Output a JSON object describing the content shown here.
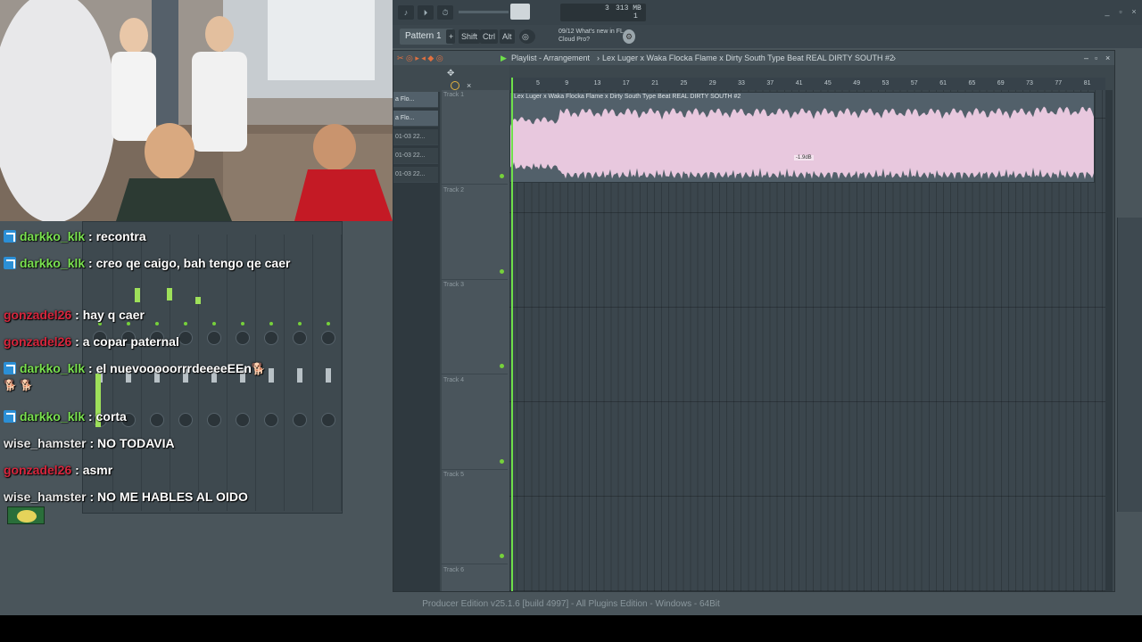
{
  "toolbar": {
    "cpu_top": "313 MB",
    "cpu_left": "3",
    "cpu_bottom": "1"
  },
  "row2": {
    "pattern": "Pattern 1",
    "shift": "Shift",
    "ctrl": "Ctrl",
    "alt": "Alt",
    "news_line1": "09/12  What's new in FL",
    "news_line2": "Cloud Pro?"
  },
  "playlist": {
    "title": "Playlist - Arrangement",
    "song": "Lex Luger x Waka Flocka Flame x Dirty South Type Beat REAL DIRTY SOUTH #2",
    "clip_label": "Lex Luger x Waka Flocka Flame x Dirty South Type Beat REAL DIRTY SOUTH #2",
    "clip_gain": "-1.9dB",
    "ruler": [
      "5",
      "9",
      "13",
      "17",
      "21",
      "25",
      "29",
      "33",
      "37",
      "41",
      "45",
      "49",
      "53",
      "57",
      "61",
      "65",
      "69",
      "73",
      "77",
      "81"
    ],
    "picker": [
      {
        "label": "a Flo..."
      },
      {
        "label": "a Flo..."
      },
      {
        "label": "01-03 22..."
      },
      {
        "label": "01-03 22..."
      },
      {
        "label": "01-03 22..."
      }
    ],
    "tracks": [
      "Track 1",
      "Track 2",
      "Track 3",
      "Track 4",
      "Track 5",
      "Track 6"
    ]
  },
  "chat": [
    {
      "user": "darkko_klk",
      "color": "green",
      "badge": true,
      "text": ": recontra"
    },
    {
      "user": "darkko_klk",
      "color": "green",
      "badge": true,
      "text": ": creo qe caigo, bah tengo qe caer"
    },
    {
      "user": "gonzadel26",
      "color": "red",
      "badge": false,
      "text": ": hay q caer"
    },
    {
      "user": "gonzadel26",
      "color": "red",
      "badge": false,
      "text": ": a copar paternal"
    },
    {
      "user": "darkko_klk",
      "color": "green",
      "badge": true,
      "text": ": el nuevooooorrrdeeeeEEn"
    },
    {
      "user": "darkko_klk",
      "color": "green",
      "badge": true,
      "text": ": corta"
    },
    {
      "user": "wise_hamster",
      "color": "white",
      "badge": false,
      "text": ": NO TODAVIA"
    },
    {
      "user": "gonzadel26",
      "color": "red",
      "badge": false,
      "text": ": asmr"
    },
    {
      "user": "wise_hamster",
      "color": "white",
      "badge": false,
      "text": ": NO ME HABLES AL OIDO"
    }
  ],
  "status": "Producer Edition v25.1.6 [build 4997] - All Plugins Edition - Windows - 64Bit",
  "colors": {
    "accent_green": "#6ee04a",
    "wave": "#e8c8de",
    "chat_green": "#79e04f",
    "chat_red": "#d7263d"
  }
}
